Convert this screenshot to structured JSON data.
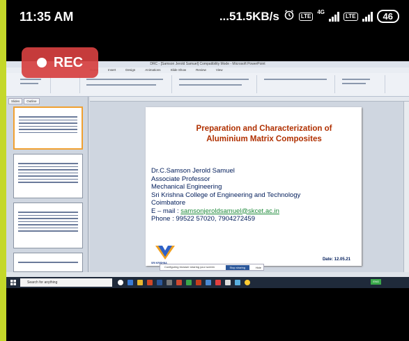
{
  "status_bar": {
    "time": "11:35 AM",
    "net_speed": "...51.5KB/s",
    "sim1_lte": "LTE",
    "sim1_net": "4G",
    "sim2_lte": "LTE",
    "battery": "46"
  },
  "recording": {
    "label": "REC"
  },
  "window": {
    "title": "DRC - [Samson Jerold Samuel] Compatibility Mode - Microsoft PowerPoint",
    "menu": [
      "Home",
      "Insert",
      "Design",
      "Animations",
      "Slide Show",
      "Review",
      "View"
    ],
    "outline_tabs": [
      "Slides",
      "Outline"
    ]
  },
  "slide": {
    "title_line1": "Preparation and Characterization of",
    "title_line2": "Aluminium Matrix Composites",
    "author": "Dr.C.Samson Jerold Samuel",
    "designation": "Associate Professor",
    "department": "Mechanical Engineering",
    "college": "Sri Krishna College of Engineering and Technology",
    "city": "Coimbatore",
    "email_prefix": "E – mail : ",
    "email": "samsonjeroldsamuel@skcet.ac.in",
    "phone": "Phone : 99522 57020, 7904272459",
    "date": "Date: 12.05.21",
    "logo_text": "SRI KRISHNA"
  },
  "notification": {
    "text": "Configuring browser sharing your screen",
    "primary_button": "Stop sharing",
    "secondary_button": "Hide"
  },
  "taskbar": {
    "search_placeholder": "Search for anything",
    "tray_badge": "ENG"
  },
  "colors": {
    "frame": "#c4d82a",
    "rec": "#d64040",
    "slide_title": "#b03000",
    "slide_text": "#001c5a",
    "email_link": "#1e8a3a"
  }
}
